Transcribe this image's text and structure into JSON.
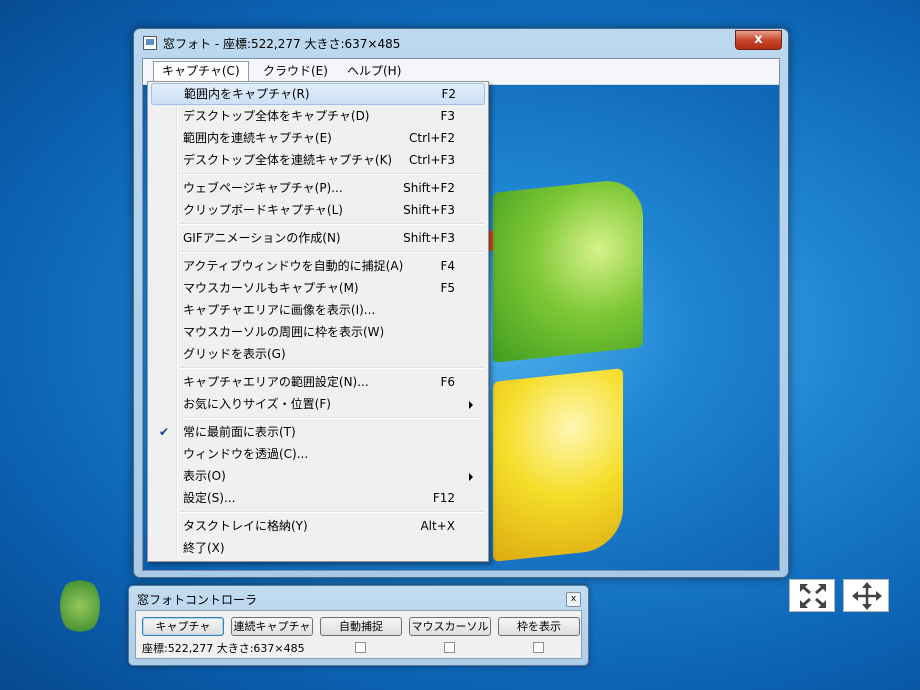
{
  "window": {
    "title": "窓フォト - 座標:522,277  大きさ:637×485",
    "close_symbol": "x"
  },
  "menubar": [
    {
      "label": "キャプチャ(C)",
      "active": true
    },
    {
      "label": "クラウド(E)",
      "active": false
    },
    {
      "label": "ヘルプ(H)",
      "active": false
    }
  ],
  "capture_menu": [
    {
      "label": "範囲内をキャプチャ(R)",
      "shortcut": "F2",
      "highlighted": true
    },
    {
      "label": "デスクトップ全体をキャプチャ(D)",
      "shortcut": "F3"
    },
    {
      "label": "範囲内を連続キャプチャ(E)",
      "shortcut": "Ctrl+F2"
    },
    {
      "label": "デスクトップ全体を連続キャプチャ(K)",
      "shortcut": "Ctrl+F3"
    },
    {
      "separator": true
    },
    {
      "label": "ウェブページキャプチャ(P)...",
      "shortcut": "Shift+F2"
    },
    {
      "label": "クリップボードキャプチャ(L)",
      "shortcut": "Shift+F3"
    },
    {
      "separator": true
    },
    {
      "label": "GIFアニメーションの作成(N)",
      "shortcut": "Shift+F3"
    },
    {
      "separator": true
    },
    {
      "label": "アクティブウィンドウを自動的に捕捉(A)",
      "shortcut": "F4"
    },
    {
      "label": "マウスカーソルもキャプチャ(M)",
      "shortcut": "F5"
    },
    {
      "label": "キャプチャエリアに画像を表示(I)...",
      "shortcut": ""
    },
    {
      "label": "マウスカーソルの周囲に枠を表示(W)",
      "shortcut": ""
    },
    {
      "label": "グリッドを表示(G)",
      "shortcut": ""
    },
    {
      "separator": true
    },
    {
      "label": "キャプチャエリアの範囲設定(N)...",
      "shortcut": "F6"
    },
    {
      "label": "お気に入りサイズ・位置(F)",
      "shortcut": "",
      "submenu": true
    },
    {
      "separator": true
    },
    {
      "label": "常に最前面に表示(T)",
      "shortcut": "",
      "checked": true
    },
    {
      "label": "ウィンドウを透過(C)...",
      "shortcut": ""
    },
    {
      "label": "表示(O)",
      "shortcut": "",
      "submenu": true
    },
    {
      "label": "設定(S)...",
      "shortcut": "F12"
    },
    {
      "separator": true
    },
    {
      "label": "タスクトレイに格納(Y)",
      "shortcut": "Alt+X"
    },
    {
      "label": "終了(X)",
      "shortcut": ""
    }
  ],
  "controller": {
    "title": "窓フォトコントローラ",
    "close_symbol": "x",
    "buttons": [
      "キャプチャ",
      "連続キャプチャ",
      "自動捕捉",
      "マウスカーソル",
      "枠を表示"
    ],
    "status": "座標:522,277  大きさ:637×485",
    "checkboxes": [
      false,
      false,
      false
    ]
  },
  "side_icons": [
    "fit-arrows-icon",
    "move-arrows-icon"
  ]
}
